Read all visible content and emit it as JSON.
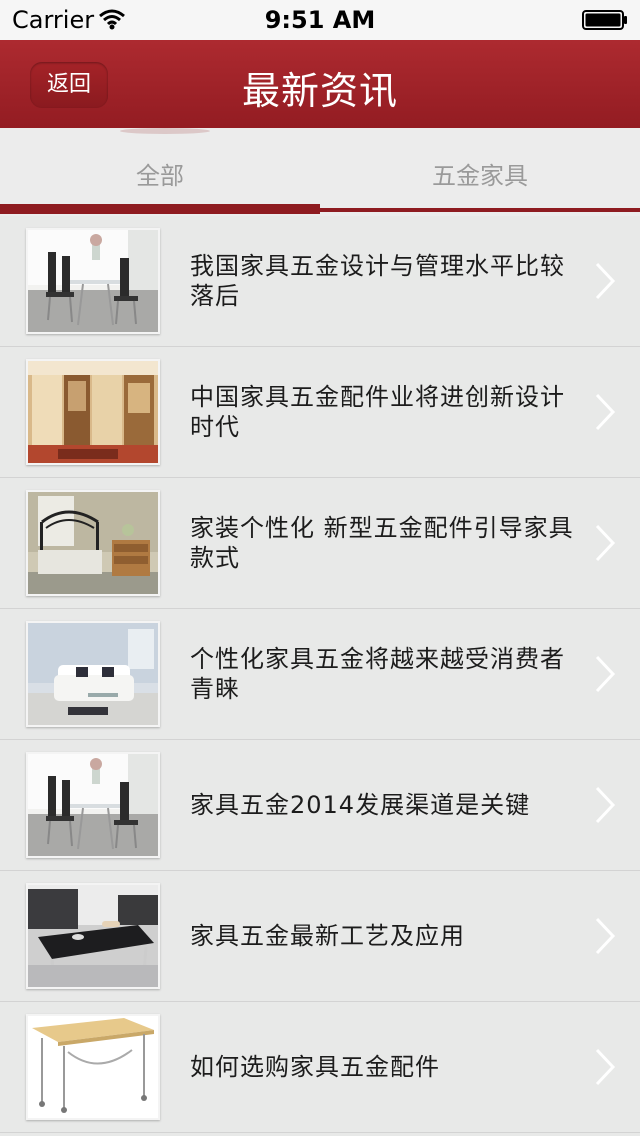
{
  "status_bar": {
    "carrier": "Carrier",
    "time": "9:51 AM",
    "wifi_icon": "wifi-icon",
    "battery_icon": "battery-full-icon"
  },
  "nav": {
    "back_label": "返回",
    "title": "最新资讯"
  },
  "tabs": [
    {
      "label": "全部",
      "active": true
    },
    {
      "label": "五金家具",
      "active": false
    }
  ],
  "colors": {
    "accent": "#9b2026",
    "tab_text": "#9a9a9a",
    "background": "#e8e9e8"
  },
  "news": [
    {
      "title": "我国家具五金设计与管理水平比较落后",
      "image": "dining-chairs"
    },
    {
      "title": "中国家具五金配件业将进创新设计时代",
      "image": "wardrobe-room"
    },
    {
      "title": "家装个性化 新型五金配件引导家具款式",
      "image": "iron-bed"
    },
    {
      "title": "个性化家具五金将越来越受消费者青睐",
      "image": "white-sofa"
    },
    {
      "title": "家具五金2014发展渠道是关键",
      "image": "dining-chairs"
    },
    {
      "title": "家具五金最新工艺及应用",
      "image": "glass-coffee-table"
    },
    {
      "title": "如何选购家具五金配件",
      "image": "folding-table"
    }
  ]
}
